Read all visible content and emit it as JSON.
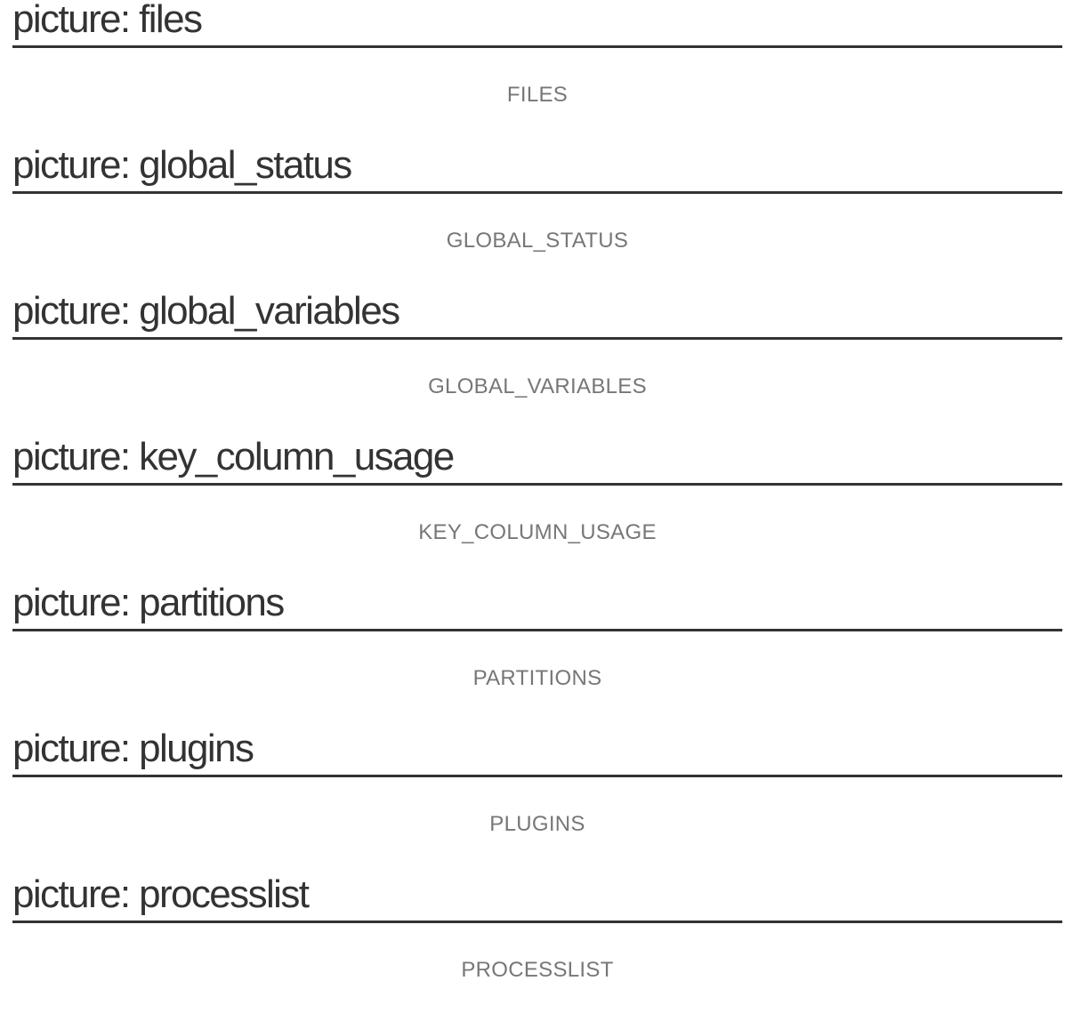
{
  "sections": [
    {
      "heading": "picture: files",
      "caption": "FILES"
    },
    {
      "heading": "picture: global_status",
      "caption": "GLOBAL_STATUS"
    },
    {
      "heading": "picture: global_variables",
      "caption": "GLOBAL_VARIABLES"
    },
    {
      "heading": "picture: key_column_usage",
      "caption": "KEY_COLUMN_USAGE"
    },
    {
      "heading": "picture: partitions",
      "caption": "PARTITIONS"
    },
    {
      "heading": "picture: plugins",
      "caption": "PLUGINS"
    },
    {
      "heading": "picture: processlist",
      "caption": "PROCESSLIST"
    }
  ]
}
